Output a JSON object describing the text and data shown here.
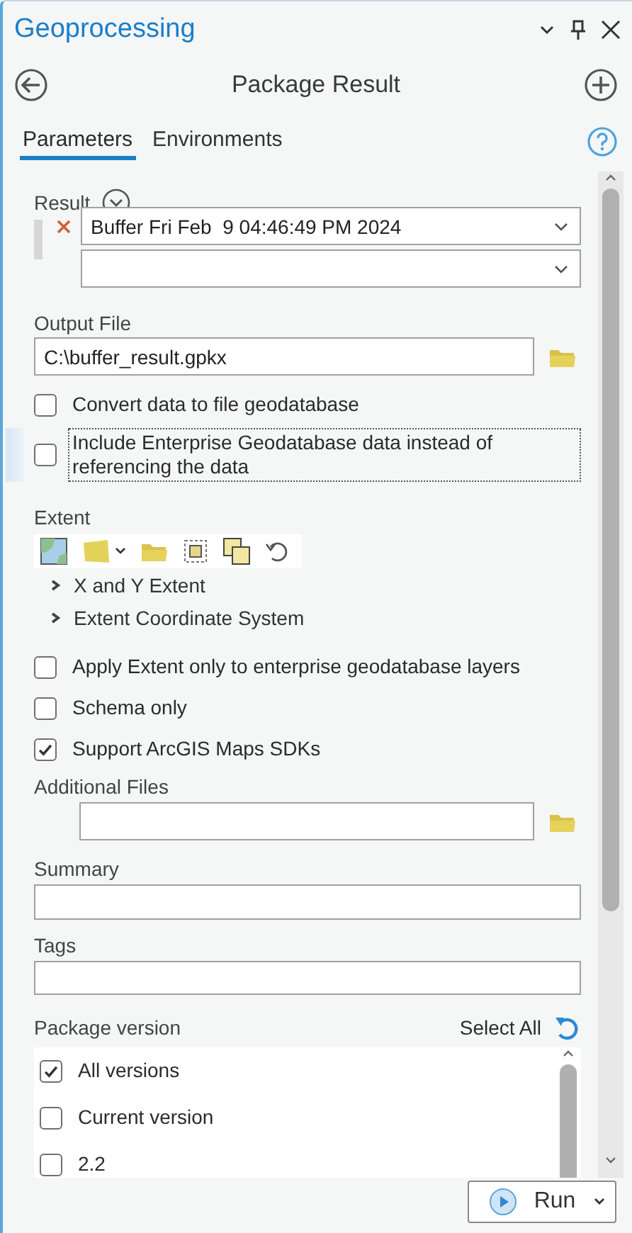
{
  "window": {
    "title": "Geoprocessing"
  },
  "tool": {
    "title": "Package Result"
  },
  "tabs": [
    {
      "label": "Parameters",
      "selected": true
    },
    {
      "label": "Environments",
      "selected": false
    }
  ],
  "result": {
    "label": "Result",
    "value": "Buffer Fri Feb  9 04:46:49 PM 2024"
  },
  "output_file": {
    "label": "Output File",
    "value": "C:\\buffer_result.gpkx"
  },
  "options": [
    {
      "label": "Convert data to file geodatabase",
      "checked": false,
      "focused": false
    },
    {
      "label": "Include Enterprise Geodatabase data instead of referencing the data",
      "checked": false,
      "focused": true
    }
  ],
  "extent": {
    "label": "Extent",
    "sections": [
      {
        "label": "X and Y Extent",
        "expanded": false
      },
      {
        "label": "Extent Coordinate System",
        "expanded": false
      }
    ]
  },
  "more_options": [
    {
      "label": "Apply Extent only to enterprise geodatabase layers",
      "checked": false
    },
    {
      "label": "Schema only",
      "checked": false
    },
    {
      "label": "Support ArcGIS Maps SDKs",
      "checked": true
    }
  ],
  "additional_files": {
    "label": "Additional Files"
  },
  "summary": {
    "label": "Summary"
  },
  "tags": {
    "label": "Tags"
  },
  "package_version": {
    "label": "Package version",
    "select_all": "Select All",
    "items": [
      {
        "label": "All versions",
        "checked": true
      },
      {
        "label": "Current version",
        "checked": false
      },
      {
        "label": "2.2",
        "checked": false
      }
    ]
  },
  "run_button": {
    "label": "Run"
  }
}
